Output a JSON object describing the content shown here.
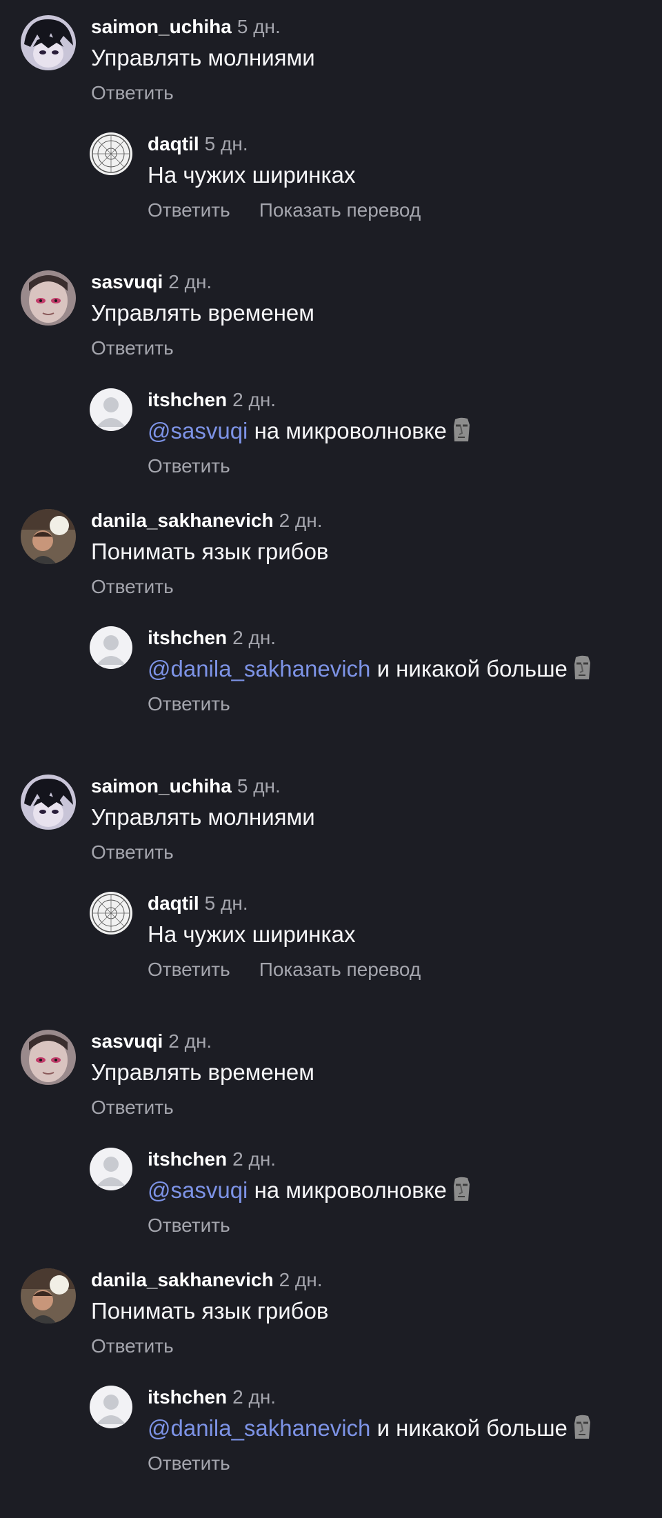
{
  "threads": [
    {
      "user": "saimon_uchiha",
      "time": "5 дн.",
      "text": "Управлять молниями",
      "reply_label": "Ответить",
      "reply": {
        "user": "daqtil",
        "time": "5 дн.",
        "mention": "",
        "text": "На чужих ширинках",
        "reply_label": "Ответить",
        "translate_label": "Показать перевод"
      }
    },
    {
      "user": "sasvuqi",
      "time": "2 дн.",
      "text": "Управлять временем",
      "reply_label": "Ответить",
      "reply": {
        "user": "itshchen",
        "time": "2 дн.",
        "mention": "@sasvuqi",
        "text": "на микроволновке",
        "reply_label": "Ответить"
      }
    },
    {
      "user": "danila_sakhanevich",
      "time": "2 дн.",
      "text": "Понимать язык грибов",
      "reply_label": "Ответить",
      "reply": {
        "user": "itshchen",
        "time": "2 дн.",
        "mention": "@danila_sakhanevich",
        "text": "и никакой больше",
        "reply_label": "Ответить"
      }
    }
  ],
  "icons": {
    "avatar_1": "anime-avatar-icon",
    "avatar_2": "astrology-chart-avatar-icon",
    "avatar_3": "face-avatar-icon",
    "avatar_4": "default-user-avatar-icon",
    "avatar_5": "photo-avatar-icon",
    "emoji": "moai-emoji-icon"
  },
  "colors": {
    "background": "#1c1d24",
    "text": "#ffffff",
    "muted": "#a4a5ad",
    "mention": "#7d93e6"
  }
}
